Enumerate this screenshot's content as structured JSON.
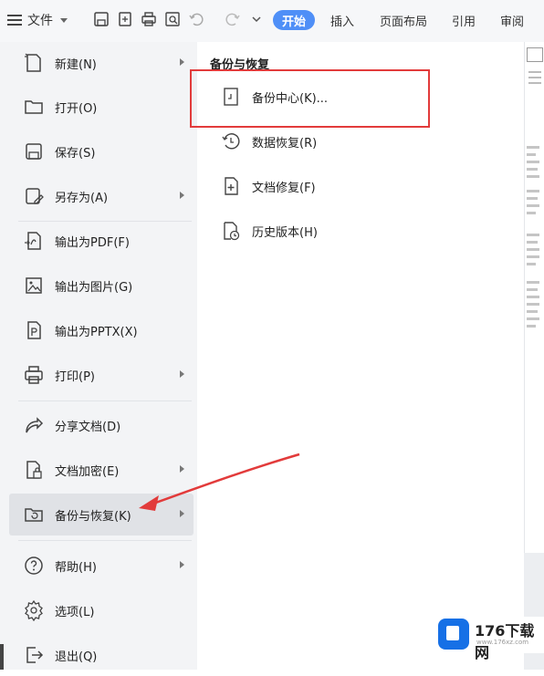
{
  "toolbar": {
    "file_label": "文件",
    "tabs": [
      "开始",
      "插入",
      "页面布局",
      "引用",
      "审阅"
    ],
    "active_tab_color": "#4f8ff7"
  },
  "menu": {
    "items": [
      {
        "label": "新建(N)",
        "icon": "new-doc-icon",
        "submenu": true
      },
      {
        "label": "打开(O)",
        "icon": "folder-icon",
        "submenu": false
      },
      {
        "label": "保存(S)",
        "icon": "save-icon",
        "submenu": false
      },
      {
        "label": "另存为(A)",
        "icon": "save-as-icon",
        "submenu": true
      },
      {
        "label": "输出为PDF(F)",
        "icon": "export-pdf-icon",
        "submenu": false
      },
      {
        "label": "输出为图片(G)",
        "icon": "export-image-icon",
        "submenu": false
      },
      {
        "label": "输出为PPTX(X)",
        "icon": "export-pptx-icon",
        "submenu": false
      },
      {
        "label": "打印(P)",
        "icon": "printer-icon",
        "submenu": true
      },
      {
        "label": "分享文档(D)",
        "icon": "share-icon",
        "submenu": false
      },
      {
        "label": "文档加密(E)",
        "icon": "encrypt-icon",
        "submenu": true
      },
      {
        "label": "备份与恢复(K)",
        "icon": "backup-restore-icon",
        "submenu": true
      },
      {
        "label": "帮助(H)",
        "icon": "help-icon",
        "submenu": true
      },
      {
        "label": "选项(L)",
        "icon": "gear-icon",
        "submenu": false
      },
      {
        "label": "退出(Q)",
        "icon": "exit-icon",
        "submenu": false
      }
    ]
  },
  "submenu": {
    "title": "备份与恢复",
    "items": [
      {
        "label": "备份中心(K)...",
        "icon": "backup-center-icon"
      },
      {
        "label": "数据恢复(R)",
        "icon": "data-restore-icon"
      },
      {
        "label": "文档修复(F)",
        "icon": "doc-repair-icon"
      },
      {
        "label": "历史版本(H)",
        "icon": "history-version-icon"
      }
    ]
  },
  "watermark": {
    "brand": "176下载网",
    "url": "www.176xz.com"
  },
  "colors": {
    "highlight_box": "#e23b3b",
    "arrow": "#e23b3b"
  }
}
